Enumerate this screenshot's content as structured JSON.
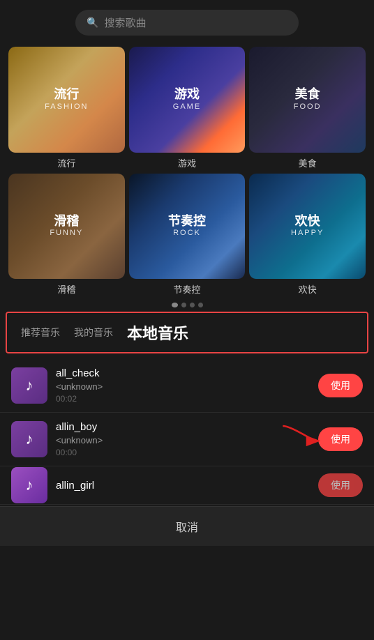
{
  "search": {
    "placeholder": "搜索歌曲",
    "icon": "🔍"
  },
  "categories": [
    {
      "id": "fashion",
      "zh": "流行",
      "en": "FASHION",
      "bg": "bg-fashion",
      "name": "流行"
    },
    {
      "id": "game",
      "zh": "游戏",
      "en": "GAME",
      "bg": "bg-game",
      "name": "游戏"
    },
    {
      "id": "food",
      "zh": "美食",
      "en": "FOOD",
      "bg": "bg-food",
      "name": "美食"
    },
    {
      "id": "funny",
      "zh": "滑稽",
      "en": "FUNNY",
      "bg": "bg-funny",
      "name": "滑稽"
    },
    {
      "id": "rock",
      "zh": "节奏控",
      "en": "ROCK",
      "bg": "bg-rock",
      "name": "节奏控"
    },
    {
      "id": "happy",
      "zh": "欢快",
      "en": "HAPPY",
      "bg": "bg-happy",
      "name": "欢快"
    }
  ],
  "tabs": [
    {
      "id": "recommend",
      "label": "推荐音乐",
      "active": false
    },
    {
      "id": "my",
      "label": "我的音乐",
      "active": false
    },
    {
      "id": "local",
      "label": "本地音乐",
      "active": true
    }
  ],
  "songs": [
    {
      "id": 1,
      "title": "all_check",
      "artist": "<unknown>",
      "duration": "00:02",
      "use_label": "使用",
      "has_arrow": false
    },
    {
      "id": 2,
      "title": "allin_boy",
      "artist": "<unknown>",
      "duration": "00:00",
      "use_label": "使用",
      "has_arrow": true
    },
    {
      "id": 3,
      "title": "allin_girl",
      "artist": "",
      "duration": "",
      "use_label": "使用",
      "has_arrow": false,
      "partial": true
    }
  ],
  "cancel_label": "取消",
  "music_note": "♪",
  "dots": [
    true,
    false,
    false,
    false
  ]
}
